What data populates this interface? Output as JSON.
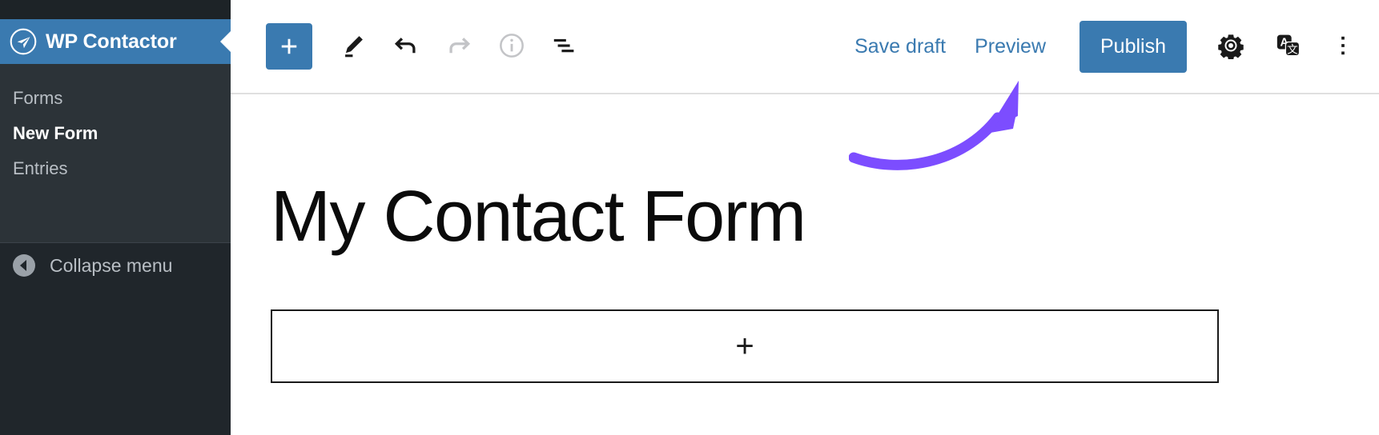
{
  "sidebar": {
    "brand": {
      "label": "WP Contactor",
      "icon": "paper-plane-icon"
    },
    "items": [
      {
        "label": "Forms",
        "active": false
      },
      {
        "label": "New Form",
        "active": true
      },
      {
        "label": "Entries",
        "active": false
      }
    ],
    "collapse": {
      "label": "Collapse menu",
      "icon": "chevron-left-circle-icon"
    },
    "colors": {
      "topbar": "#1d2327",
      "background": "#2c3338",
      "active_item": "#3a7ab0",
      "footer": "#20262b",
      "text": "#b9bfc5"
    }
  },
  "header": {
    "tools": [
      {
        "name": "add-block",
        "icon": "plus-icon",
        "state": "primary"
      },
      {
        "name": "edit-tool",
        "icon": "pencil-icon",
        "state": "enabled"
      },
      {
        "name": "undo",
        "icon": "undo-arrow-icon",
        "state": "enabled"
      },
      {
        "name": "redo",
        "icon": "redo-arrow-icon",
        "state": "disabled"
      },
      {
        "name": "details",
        "icon": "info-circle-icon",
        "state": "disabled"
      },
      {
        "name": "list-view",
        "icon": "list-view-icon",
        "state": "enabled"
      }
    ],
    "save_draft_label": "Save draft",
    "preview_label": "Preview",
    "publish_label": "Publish",
    "settings_icon": "gear-icon",
    "translate_icon": "translate-icon",
    "more_icon": "more-vertical-icon",
    "accent_color": "#3a7ab0",
    "link_color": "#3a7ab0"
  },
  "canvas": {
    "post_title": "My Contact Form",
    "block_appender": {
      "icon": "plus-icon",
      "glyph": "+"
    }
  },
  "annotation": {
    "type": "curved-arrow",
    "points_to": "publish-button",
    "color": "#7c4dff"
  }
}
